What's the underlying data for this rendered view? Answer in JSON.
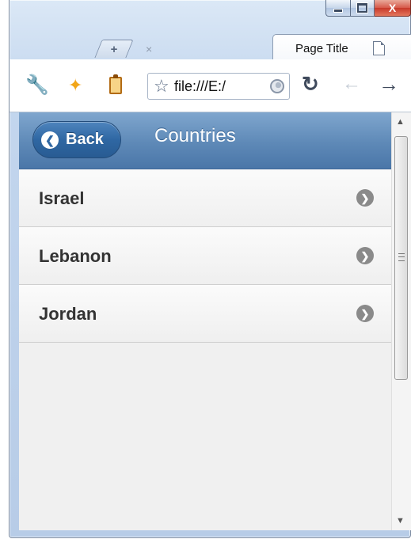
{
  "window": {
    "tab_title": "Page Title",
    "new_tab_symbol": "+",
    "close_symbol": "×",
    "caption_close": "X"
  },
  "toolbar": {
    "address": "file:///E:/"
  },
  "header": {
    "back_label": "Back",
    "title": "Countries"
  },
  "list": {
    "items": [
      {
        "label": "Israel"
      },
      {
        "label": "Lebanon"
      },
      {
        "label": "Jordan"
      }
    ]
  },
  "colors": {
    "header": "#5e89b7",
    "back_button": "#2f67a3",
    "list_text": "#333333"
  }
}
